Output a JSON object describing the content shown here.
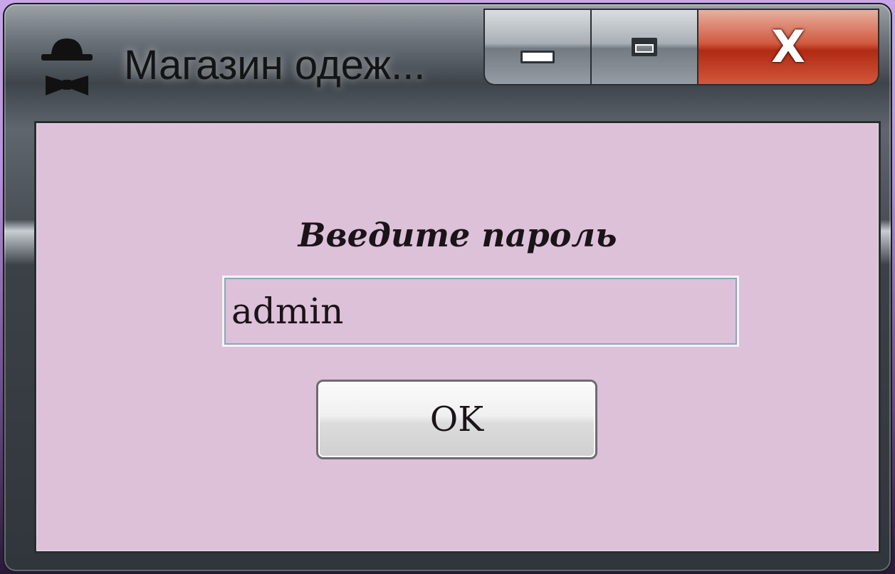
{
  "window": {
    "title": "Магазин одеж...",
    "app_icon": "hat-bowtie-icon",
    "controls": {
      "minimize_icon": "minimize-icon",
      "maximize_icon": "maximize-icon",
      "close_label": "X"
    }
  },
  "form": {
    "prompt": "Введите пароль",
    "password_value": "admin",
    "ok_label": "OK"
  },
  "colors": {
    "client_background": "#dcc1d9",
    "close_button": "#c8402a",
    "desktop": "#b890dc"
  }
}
